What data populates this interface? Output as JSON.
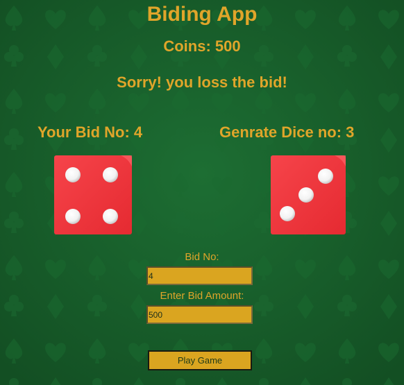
{
  "app": {
    "title": "Biding App"
  },
  "status": {
    "coins_text": "Coins: 500",
    "coins": 500,
    "result_message": "Sorry! you loss the bid!"
  },
  "bid": {
    "label": "Your Bid No: 4",
    "value": 4,
    "die_face": 4
  },
  "dice": {
    "label": "Genrate Dice no: 3",
    "value": 3,
    "die_face": 3
  },
  "form": {
    "bid_no_label": "Bid No:",
    "bid_no_value": "4",
    "amount_label": "Enter Bid Amount:",
    "amount_value": "500",
    "play_button_label": "Play Game"
  },
  "colors": {
    "background": "#17602b",
    "accent_gold": "#e0a52a",
    "die_red": "#f0343a",
    "field_gold": "#daa520"
  },
  "icons": {
    "left_die": "dice-four-icon",
    "right_die": "dice-three-icon",
    "background": "card-suit-pattern"
  }
}
